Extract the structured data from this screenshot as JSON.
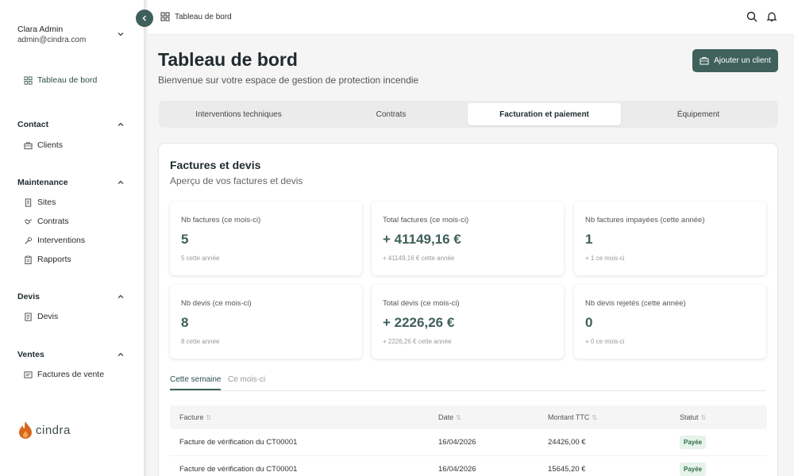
{
  "user": {
    "name": "Clara Admin",
    "email": "admin@cindra.com"
  },
  "sidebar": {
    "dashboard_label": "Tableau de bord",
    "sections": [
      {
        "title": "Contact",
        "items": [
          "Clients"
        ]
      },
      {
        "title": "Maintenance",
        "items": [
          "Sites",
          "Contrats",
          "Interventions",
          "Rapports"
        ]
      },
      {
        "title": "Devis",
        "items": [
          "Devis"
        ]
      },
      {
        "title": "Ventes",
        "items": [
          "Factures de vente"
        ]
      }
    ]
  },
  "brand": {
    "name": "cindra",
    "accent": "#d9651c"
  },
  "header": {
    "breadcrumb": "Tableau de bord"
  },
  "page": {
    "title": "Tableau de bord",
    "subtitle": "Bienvenue sur votre espace de gestion de protection incendie",
    "add_client_label": "Ajouter un client"
  },
  "tabs": [
    "Interventions techniques",
    "Contrats",
    "Facturation et paiement",
    "Équipement"
  ],
  "active_tab": "Facturation et paiement",
  "card": {
    "title": "Factures et devis",
    "subtitle": "Aperçu de vos factures et devis",
    "stats": [
      {
        "label": "Nb factures (ce mois-ci)",
        "value": "5",
        "sub": "5 cette année"
      },
      {
        "label": "Total factures (ce mois-ci)",
        "value": "+ 41149,16 €",
        "sub": "+ 41149,16 € cette année"
      },
      {
        "label": "Nb factures impayées (cette année)",
        "value": "1",
        "sub": "+ 1 ce mois-ci"
      },
      {
        "label": "Nb devis (ce mois-ci)",
        "value": "8",
        "sub": "8 cette année"
      },
      {
        "label": "Total devis (ce mois-ci)",
        "value": "+ 2226,26 €",
        "sub": "+ 2226,26 € cette année"
      },
      {
        "label": "Nb devis rejetés (cette année)",
        "value": "0",
        "sub": "+ 0 ce mois-ci"
      }
    ],
    "period_tabs": [
      "Cette semaine",
      "Ce mois-ci"
    ],
    "table": {
      "columns": [
        "Facture",
        "Date",
        "Montant TTC",
        "Statut"
      ],
      "rows": [
        {
          "facture": "Facture de vérification du CT00001",
          "date": "16/04/2026",
          "montant": "24426,00 €",
          "statut": "Payée"
        },
        {
          "facture": "Facture de vérification du CT00001",
          "date": "16/04/2026",
          "montant": "15645,20 €",
          "statut": "Payée"
        }
      ]
    }
  },
  "colors": {
    "primary": "#3f615c",
    "paid_badge_bg": "#e5f3ea",
    "paid_badge_text": "#2f6b45"
  }
}
